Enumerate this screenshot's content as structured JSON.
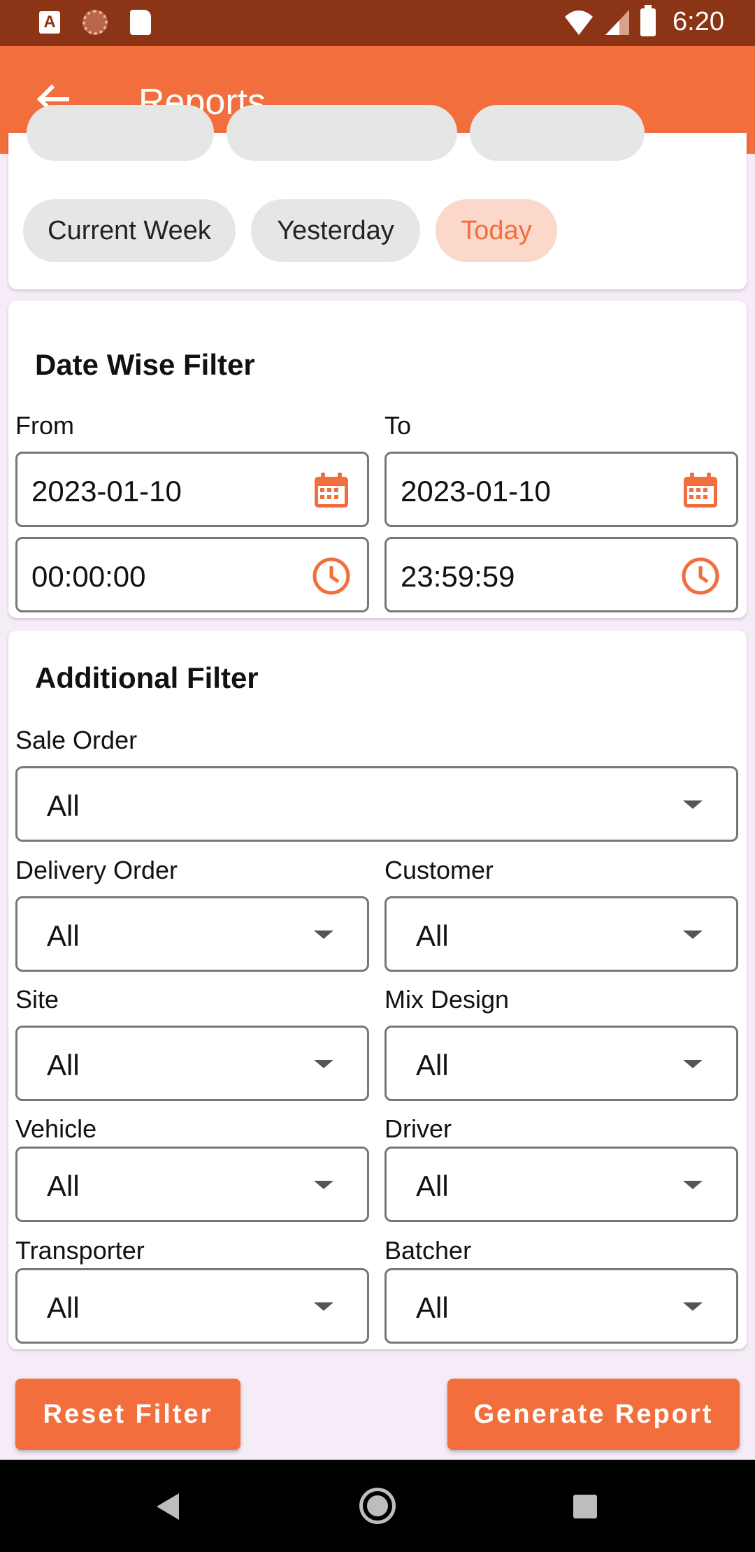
{
  "status_bar": {
    "time": "6:20",
    "left_icon_a": "A"
  },
  "app_bar": {
    "title": "Reports"
  },
  "quick_filters": {
    "chips": [
      {
        "label": "Current Week",
        "selected": false
      },
      {
        "label": "Yesterday",
        "selected": false
      },
      {
        "label": "Today",
        "selected": true
      }
    ]
  },
  "date_filter": {
    "title": "Date Wise Filter",
    "from_label": "From",
    "to_label": "To",
    "from_date": "2023-01-10",
    "to_date": "2023-01-10",
    "from_time": "00:00:00",
    "to_time": "23:59:59"
  },
  "additional_filter": {
    "title": "Additional Filter",
    "sale_order": {
      "label": "Sale Order",
      "value": "All"
    },
    "delivery_order": {
      "label": "Delivery Order",
      "value": "All"
    },
    "customer": {
      "label": "Customer",
      "value": "All"
    },
    "site": {
      "label": "Site",
      "value": "All"
    },
    "mix_design": {
      "label": "Mix Design",
      "value": "All"
    },
    "vehicle": {
      "label": "Vehicle",
      "value": "All"
    },
    "driver": {
      "label": "Driver",
      "value": "All"
    },
    "transporter": {
      "label": "Transporter",
      "value": "All"
    },
    "batcher": {
      "label": "Batcher",
      "value": "All"
    }
  },
  "actions": {
    "reset_label": "Reset Filter",
    "generate_label": "Generate Report"
  },
  "colors": {
    "accent": "#f26e3d",
    "status_bar": "#8b3416",
    "chip_selected_bg": "#fcd8cb"
  }
}
